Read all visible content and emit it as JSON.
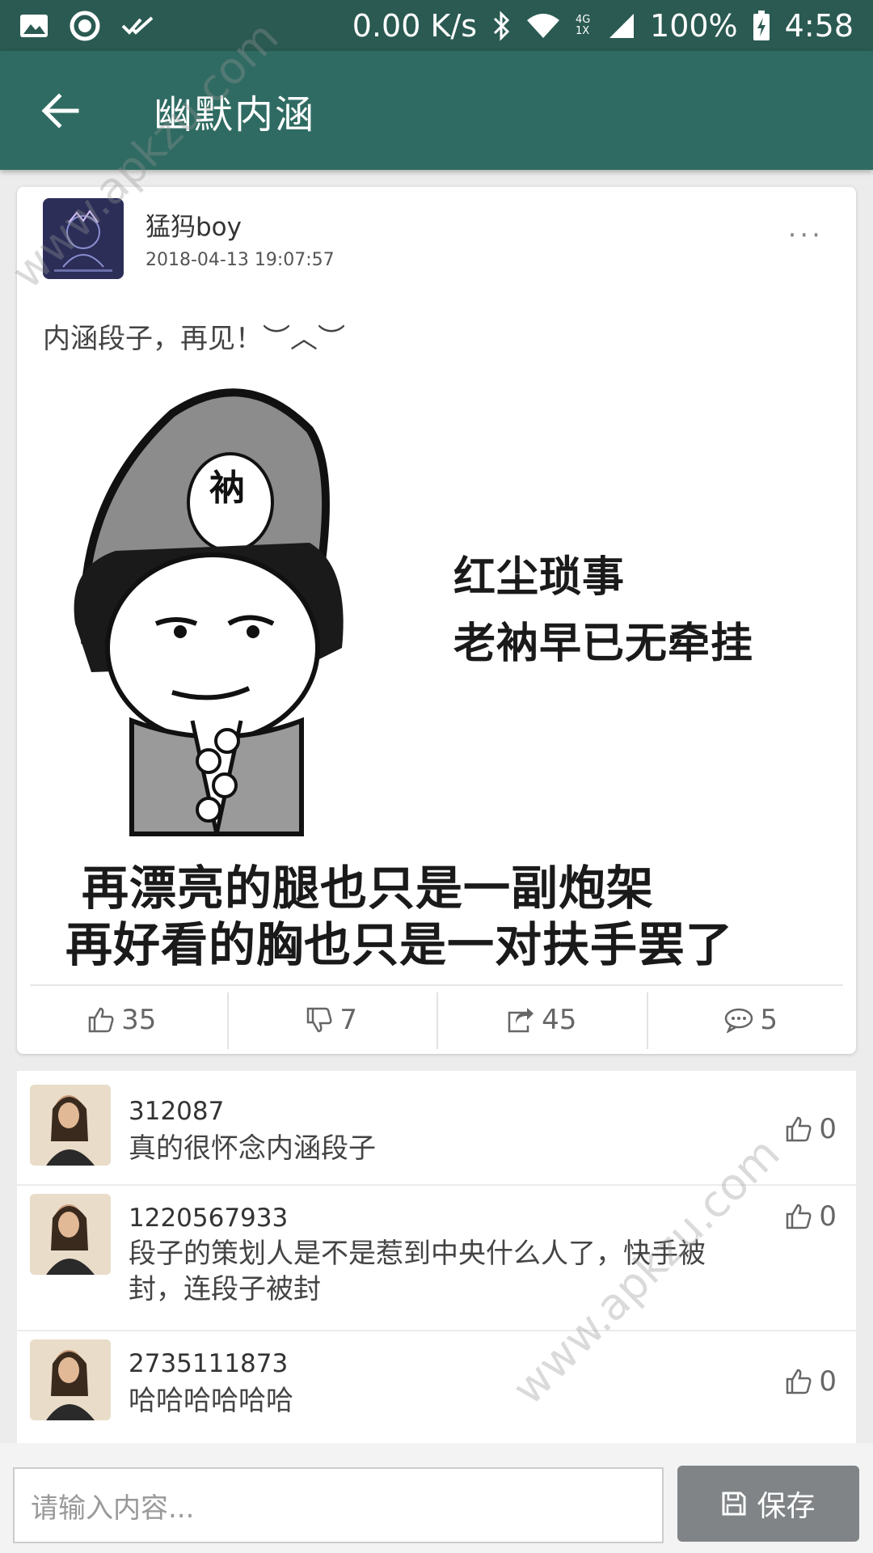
{
  "status_bar": {
    "speed": "0.00 K/s",
    "network": "4G 1X",
    "battery": "100%",
    "time": "4:58",
    "left_icons": [
      "image-icon",
      "record-icon",
      "check-icon"
    ],
    "right_icons": [
      "bluetooth-icon",
      "wifi-icon",
      "signal-icon",
      "battery-icon"
    ]
  },
  "app_bar": {
    "title": "幽默内涵",
    "back_icon": "arrow-left-icon"
  },
  "post": {
    "user": "猛犸boy",
    "time": "2018-04-13 19:07:57",
    "more": "···",
    "text": "内涵段子，再见！︶︿︶",
    "image": {
      "hat_mark": "衲",
      "caption_right_1": "红尘琐事",
      "caption_right_2": "老衲早已无牵挂",
      "caption_bottom_1": "再漂亮的腿也只是一副炮架",
      "caption_bottom_2": "再好看的胸也只是一对扶手罢了"
    },
    "actions": {
      "like": "35",
      "dislike": "7",
      "share": "45",
      "comment": "5"
    }
  },
  "comments": [
    {
      "user": "312087",
      "text": "真的很怀念内涵段子",
      "likes": "0"
    },
    {
      "user": "1220567933",
      "text": "段子的策划人是不是惹到中央什么人了，快手被封，连段子被封",
      "likes": "0"
    },
    {
      "user": "2735111873",
      "text": "哈哈哈哈哈哈",
      "likes": "0"
    }
  ],
  "input": {
    "placeholder": "请输入内容...",
    "save_label": "保存"
  },
  "watermark": "www.apkzu.com",
  "colors": {
    "status_bar": "#2a5a52",
    "app_bar": "#2f6b62",
    "save_button": "#808487"
  }
}
